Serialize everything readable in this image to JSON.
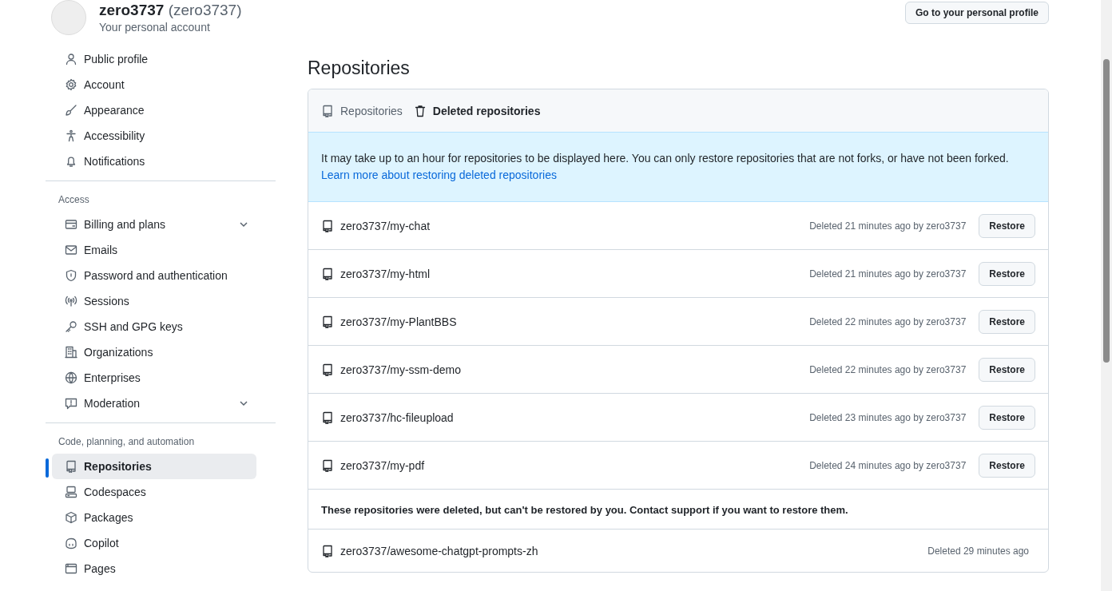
{
  "account": {
    "name": "zero3737",
    "login": "(zero3737)",
    "subtitle": "Your personal account",
    "profile_button": "Go to your personal profile"
  },
  "sidebar": {
    "sections": [
      {
        "items": [
          {
            "label": "Public profile",
            "selected": false,
            "expandable": false
          },
          {
            "label": "Account",
            "selected": false,
            "expandable": false
          },
          {
            "label": "Appearance",
            "selected": false,
            "expandable": false
          },
          {
            "label": "Accessibility",
            "selected": false,
            "expandable": false
          },
          {
            "label": "Notifications",
            "selected": false,
            "expandable": false
          }
        ]
      },
      {
        "heading": "Access",
        "items": [
          {
            "label": "Billing and plans",
            "selected": false,
            "expandable": true
          },
          {
            "label": "Emails",
            "selected": false,
            "expandable": false
          },
          {
            "label": "Password and authentication",
            "selected": false,
            "expandable": false
          },
          {
            "label": "Sessions",
            "selected": false,
            "expandable": false
          },
          {
            "label": "SSH and GPG keys",
            "selected": false,
            "expandable": false
          },
          {
            "label": "Organizations",
            "selected": false,
            "expandable": false
          },
          {
            "label": "Enterprises",
            "selected": false,
            "expandable": false
          },
          {
            "label": "Moderation",
            "selected": false,
            "expandable": true
          }
        ]
      },
      {
        "heading": "Code, planning, and automation",
        "items": [
          {
            "label": "Repositories",
            "selected": true,
            "expandable": false
          },
          {
            "label": "Codespaces",
            "selected": false,
            "expandable": false
          },
          {
            "label": "Packages",
            "selected": false,
            "expandable": false
          },
          {
            "label": "Copilot",
            "selected": false,
            "expandable": false
          },
          {
            "label": "Pages",
            "selected": false,
            "expandable": false
          }
        ]
      }
    ]
  },
  "title": "Repositories",
  "tabs": [
    {
      "label": "Repositories",
      "selected": false
    },
    {
      "label": "Deleted repositories",
      "selected": true
    }
  ],
  "notice": {
    "text": "It may take up to an hour for repositories to be displayed here. You can only restore repositories that are not forks, or have not been forked.",
    "link": "Learn more about restoring deleted repositories"
  },
  "restorable": [
    {
      "name": "zero3737/my-chat",
      "deleted": "Deleted 21 minutes ago by zero3737",
      "button": "Restore"
    },
    {
      "name": "zero3737/my-html",
      "deleted": "Deleted 21 minutes ago by zero3737",
      "button": "Restore"
    },
    {
      "name": "zero3737/my-PlantBBS",
      "deleted": "Deleted 22 minutes ago by zero3737",
      "button": "Restore"
    },
    {
      "name": "zero3737/my-ssm-demo",
      "deleted": "Deleted 22 minutes ago by zero3737",
      "button": "Restore"
    },
    {
      "name": "zero3737/hc-fileupload",
      "deleted": "Deleted 23 minutes ago by zero3737",
      "button": "Restore"
    },
    {
      "name": "zero3737/my-pdf",
      "deleted": "Deleted 24 minutes ago by zero3737",
      "button": "Restore"
    }
  ],
  "unrestorable_note": "These repositories were deleted, but can't be restored by you. Contact support if you want to restore them.",
  "unrestorable": [
    {
      "name": "zero3737/awesome-chatgpt-prompts-zh",
      "deleted": "Deleted 29 minutes ago"
    }
  ]
}
